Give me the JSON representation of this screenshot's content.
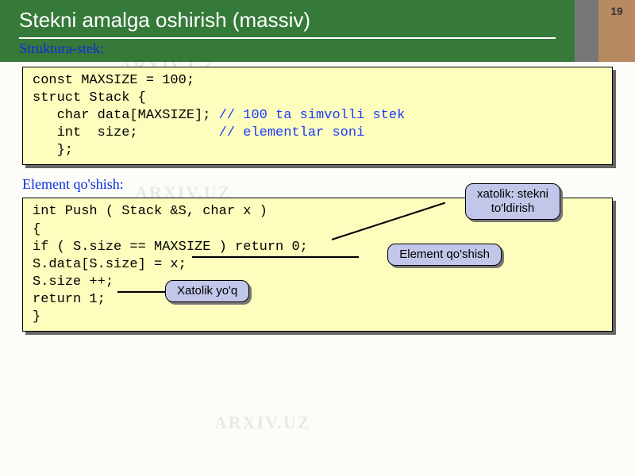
{
  "page_number": "19",
  "title": "Stekni amalga oshirish (massiv)",
  "section1_label": "Struktura-stek:",
  "code1": {
    "l1": "const MAXSIZE = 100;",
    "l2": "struct Stack {",
    "l3a": "   char data[MAXSIZE]; ",
    "l3b": "// 100 ta simvolli stek",
    "l4a": "   int  size;          ",
    "l4b": "// elementlar soni",
    "l5": "   };"
  },
  "section2_label": "Element qo'shish:",
  "code2": {
    "l1": "int Push ( Stack &S, char x )",
    "l2": "{",
    "l3": "if ( S.size == MAXSIZE ) return 0;",
    "l4": "S.data[S.size] = x;",
    "l5": "S.size ++;",
    "l6": "return 1;",
    "l7": "}"
  },
  "callouts": {
    "c1_line1": "xatolik: stekni",
    "c1_line2": "to'ldirish",
    "c2": "Element qo'shish",
    "c3": "Xatolik yo'q"
  },
  "watermark": "ARXIV.UZ"
}
